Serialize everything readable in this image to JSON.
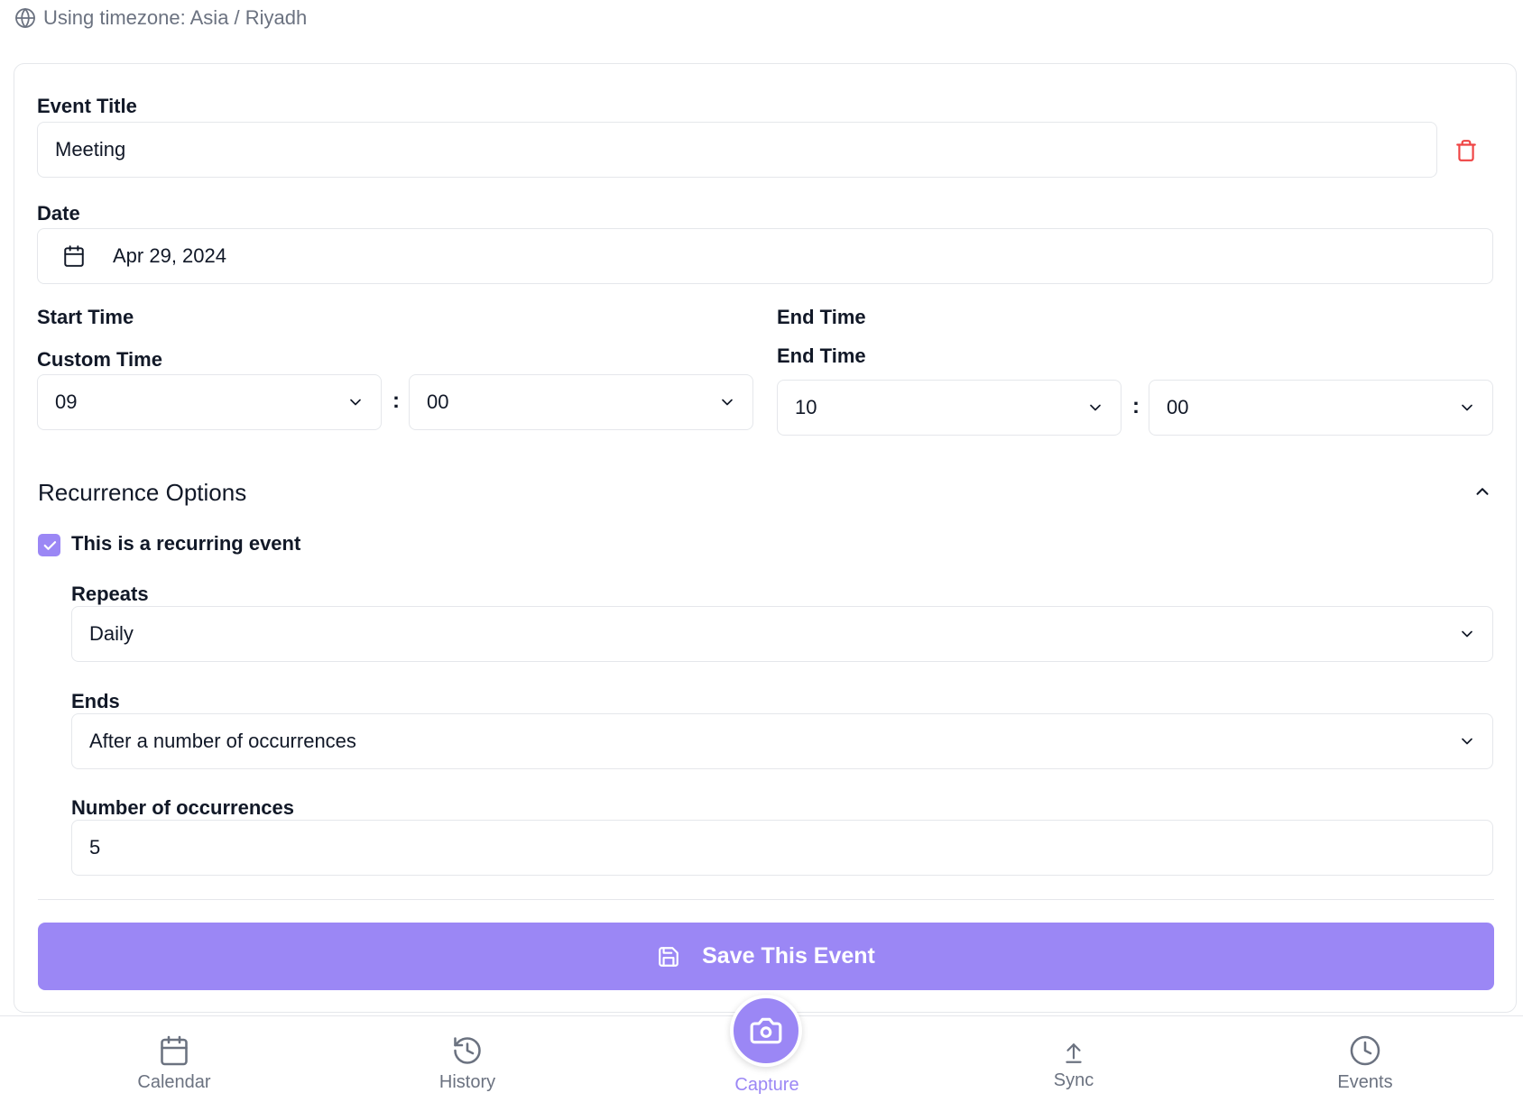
{
  "timezone": {
    "text": "Using timezone: Asia / Riyadh"
  },
  "form": {
    "title_label": "Event Title",
    "title_value": "Meeting",
    "date_label": "Date",
    "date_value": "Apr 29, 2024",
    "start": {
      "label": "Start Time",
      "sub_label": "Custom Time",
      "hour": "09",
      "minute": "00"
    },
    "end": {
      "label": "End Time",
      "sub_label": "End Time",
      "hour": "10",
      "minute": "00"
    },
    "time_separator": ":",
    "recurrence": {
      "title": "Recurrence Options",
      "checkbox_label": "This is a recurring event",
      "checked": true,
      "repeats_label": "Repeats",
      "repeats_value": "Daily",
      "ends_label": "Ends",
      "ends_value": "After a number of occurrences",
      "occurrences_label": "Number of occurrences",
      "occurrences_value": "5"
    },
    "save_label": "Save This Event"
  },
  "nav": {
    "items": [
      {
        "label": "Calendar",
        "icon": "calendar-icon"
      },
      {
        "label": "History",
        "icon": "history-icon"
      },
      {
        "label": "Capture",
        "icon": "camera-icon",
        "active": true
      },
      {
        "label": "Sync",
        "icon": "upload-icon"
      },
      {
        "label": "Events",
        "icon": "clock-icon"
      }
    ]
  },
  "colors": {
    "accent": "#9b87f5",
    "danger": "#ef4444",
    "muted": "#6b7280",
    "border": "#e5e7eb"
  }
}
